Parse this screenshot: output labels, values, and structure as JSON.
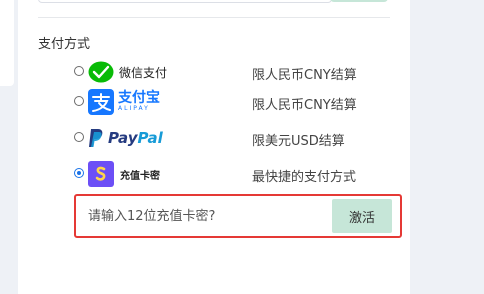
{
  "payment": {
    "section_title": "支付方式",
    "methods": [
      {
        "id": "wechat",
        "name": "微信支付",
        "note": "限人民币CNY结算",
        "checked": false
      },
      {
        "id": "alipay",
        "name": "支付宝",
        "name_en": "ALIPAY",
        "note": "限人民币CNY结算",
        "checked": false
      },
      {
        "id": "paypal",
        "name_part1": "Pay",
        "name_part2": "Pal",
        "note": "限美元USD结算",
        "checked": false
      },
      {
        "id": "card",
        "name": "充值卡密",
        "note": "最快捷的支付方式",
        "checked": true
      }
    ]
  },
  "activation": {
    "placeholder": "请输入12位充值卡密?",
    "button_label": "激活"
  },
  "colors": {
    "accent_green": "#c6e6d8",
    "highlight_red": "#e53935",
    "wechat_green": "#09bb07",
    "alipay_blue": "#1677ff",
    "card_purple": "#6c4ff6"
  }
}
